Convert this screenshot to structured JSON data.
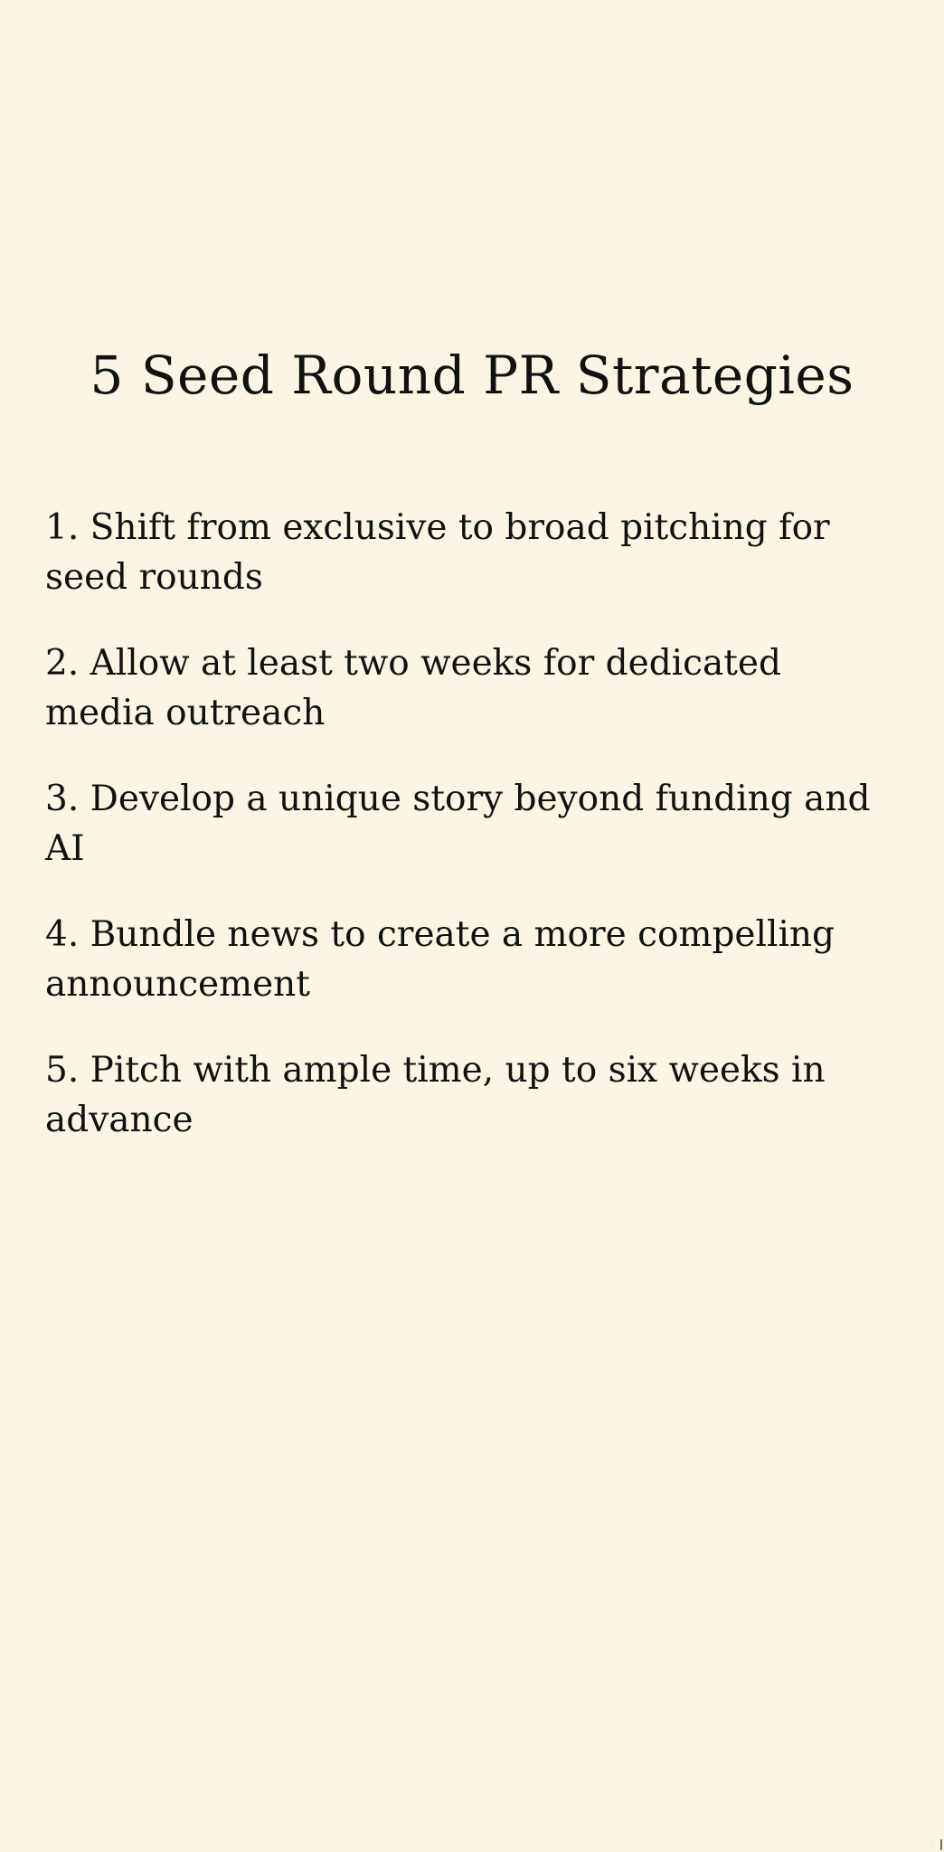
{
  "document": {
    "title": "5 Seed Round PR Strategies",
    "items": [
      "1. Shift from exclusive to broad pitching for seed rounds",
      "2. Allow at least two weeks for dedicated media outreach",
      "3. Develop a unique story beyond funding and AI",
      "4. Bundle news to create a more compelling announcement",
      "5. Pitch with ample time, up to six weeks in advance"
    ]
  },
  "colors": {
    "background": "#fcf5e3",
    "text": "#111111"
  }
}
